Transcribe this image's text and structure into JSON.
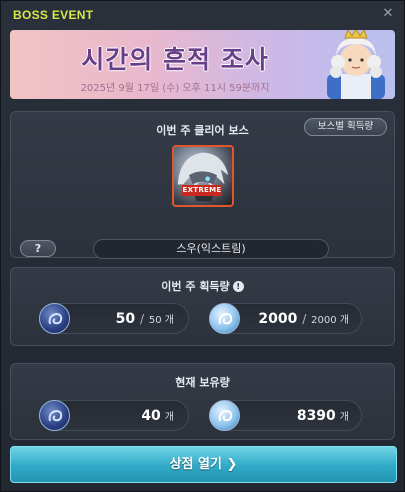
{
  "window": {
    "title": "BOSS EVENT",
    "close_glyph": "✕"
  },
  "banner": {
    "title": "시간의 흔적 조사",
    "date": "2025년 9월 17일 (수) 오후 11시 59분까지",
    "character_icon": "queen-character-icon"
  },
  "cleared": {
    "title": "이번 주 클리어 보스",
    "per_boss_button": "보스별 획득량",
    "boss_badge": "EXTREME",
    "help_label": "?",
    "boss_name": "스우(익스트림)"
  },
  "weekly": {
    "title": "이번 주 획득량",
    "info_glyph": "!",
    "blue": {
      "current": "50",
      "sep": "/",
      "max": "50 개"
    },
    "light": {
      "current": "2000",
      "sep": "/",
      "max": "2000 개"
    }
  },
  "holding": {
    "title": "현재 보유량",
    "blue": {
      "value": "40",
      "unit": "개"
    },
    "light": {
      "value": "8390",
      "unit": "개"
    }
  },
  "shop": {
    "label": "상점 열기 ❯"
  },
  "colors": {
    "title_accent": "#d7e84a",
    "button_cyan": "#2fa9c7",
    "badge_red": "#c8281e"
  }
}
